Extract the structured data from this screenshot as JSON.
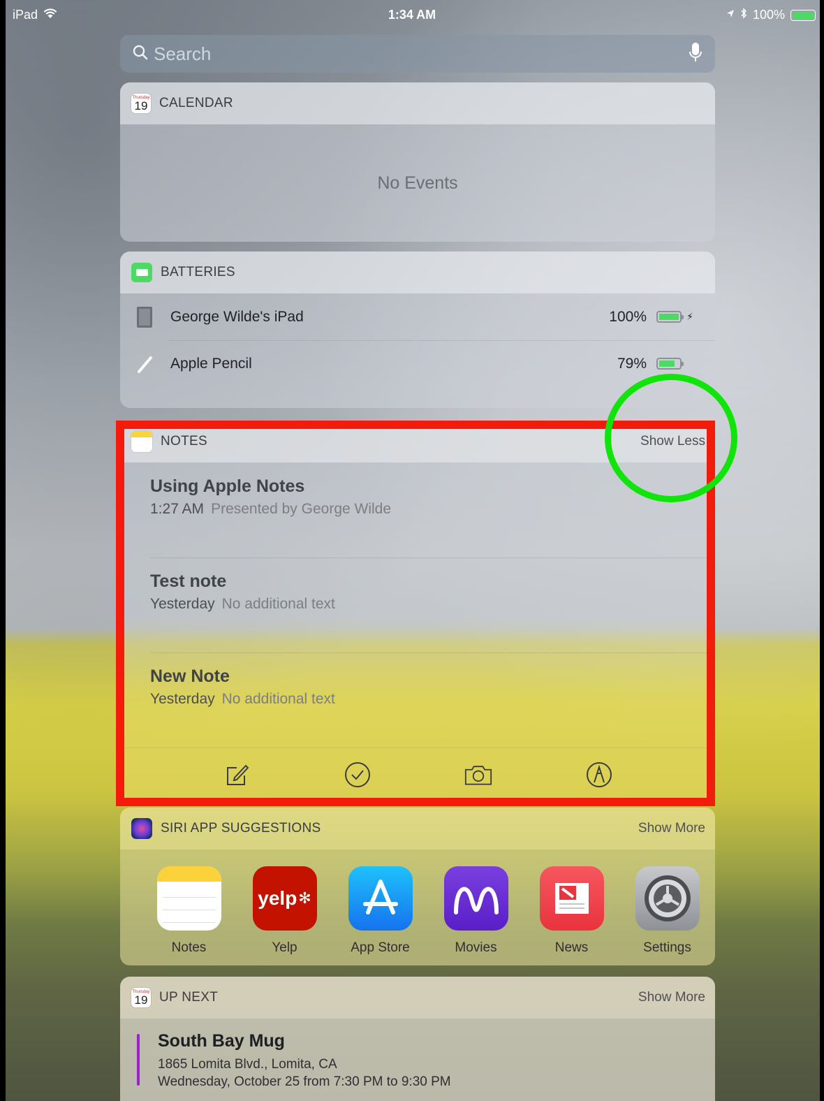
{
  "status_bar": {
    "device": "iPad",
    "time": "1:34 AM",
    "battery": "100%"
  },
  "search": {
    "placeholder": "Search"
  },
  "calendar_widget": {
    "icon_day": "Thursday",
    "icon_date": "19",
    "title": "CALENDAR",
    "empty_text": "No Events"
  },
  "batteries_widget": {
    "title": "BATTERIES",
    "devices": [
      {
        "name": "George Wilde's iPad",
        "percent": "100%",
        "level": 1.0,
        "charging": true
      },
      {
        "name": "Apple Pencil",
        "percent": "79%",
        "level": 0.79,
        "charging": false
      }
    ]
  },
  "notes_widget": {
    "title": "NOTES",
    "action": "Show Less",
    "notes": [
      {
        "title": "Using Apple Notes",
        "time": "1:27 AM",
        "preview": "Presented by George Wilde"
      },
      {
        "title": "Test note",
        "time": "Yesterday",
        "preview": "No additional text"
      },
      {
        "title": "New Note",
        "time": "Yesterday",
        "preview": "No additional text"
      }
    ],
    "toolbar": [
      "compose-icon",
      "checklist-icon",
      "camera-icon",
      "sketch-icon"
    ]
  },
  "siri_widget": {
    "title": "SIRI APP SUGGESTIONS",
    "action": "Show More",
    "apps": [
      {
        "label": "Notes",
        "icon": "notes-app-icon"
      },
      {
        "label": "Yelp",
        "icon": "yelp-app-icon",
        "glyph": "yelp"
      },
      {
        "label": "App Store",
        "icon": "app-store-app-icon"
      },
      {
        "label": "Movies",
        "icon": "movies-app-icon"
      },
      {
        "label": "News",
        "icon": "news-app-icon"
      },
      {
        "label": "Settings",
        "icon": "settings-app-icon"
      }
    ]
  },
  "upnext_widget": {
    "icon_day": "Thursday",
    "icon_date": "19",
    "title": "UP NEXT",
    "action": "Show More",
    "event": {
      "title": "South Bay Mug",
      "address": "1865 Lomita Blvd., Lomita, CA",
      "time": "Wednesday, October 25 from 7:30 PM to 9:30 PM"
    }
  },
  "colors": {
    "annotation_box": "#f41b0c",
    "annotation_circle": "#10e40a",
    "battery_green": "#4cd964",
    "event_bar": "#a020d0"
  }
}
